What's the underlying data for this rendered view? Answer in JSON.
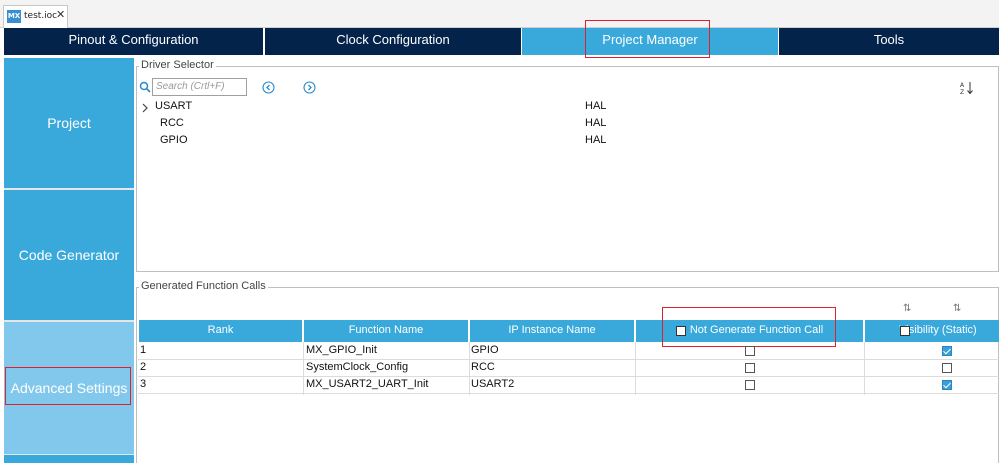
{
  "editor": {
    "file_tab": {
      "icon_label": "MX",
      "name": "test.ioc",
      "close_glyph": "✕"
    }
  },
  "main_tabs": [
    {
      "label": "Pinout & Configuration"
    },
    {
      "label": "Clock Configuration"
    },
    {
      "label": "Project Manager"
    },
    {
      "label": "Tools"
    }
  ],
  "left_nav": [
    {
      "label": "Project"
    },
    {
      "label": "Code Generator"
    },
    {
      "label": "Advanced Settings"
    }
  ],
  "driver_selector": {
    "title": "Driver Selector",
    "search_placeholder": "Search (Crtl+F)",
    "rows": [
      {
        "name": "USART",
        "driver": "HAL",
        "expandable": true
      },
      {
        "name": "RCC",
        "driver": "HAL",
        "expandable": false
      },
      {
        "name": "GPIO",
        "driver": "HAL",
        "expandable": false
      }
    ]
  },
  "generated_calls": {
    "title": "Generated Function Calls",
    "columns": [
      "Rank",
      "Function Name",
      "IP Instance Name",
      "Not Generate Function Call",
      "Visibility (Static)"
    ],
    "rows": [
      {
        "rank": "1",
        "function": "MX_GPIO_Init",
        "instance": "GPIO",
        "not_generate": false,
        "visibility": true
      },
      {
        "rank": "2",
        "function": "SystemClock_Config",
        "instance": "RCC",
        "not_generate": false,
        "visibility": false
      },
      {
        "rank": "3",
        "function": "MX_USART2_UART_Init",
        "instance": "USART2",
        "not_generate": false,
        "visibility": true
      }
    ]
  },
  "colors": {
    "tab_dark": "#03234b",
    "accent": "#39a9dc",
    "highlight": "#e0202a"
  }
}
